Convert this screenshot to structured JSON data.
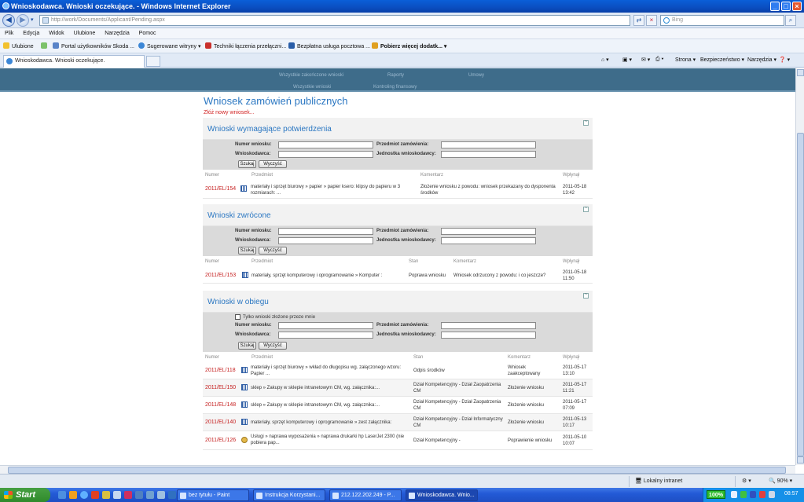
{
  "window": {
    "title": "Wnioskodawca. Wnioski oczekujące. - Windows Internet Explorer"
  },
  "address": {
    "url": "http://work/Documents/Applicant/Pending.aspx",
    "search_placeholder": "Bing"
  },
  "menu": [
    "Plik",
    "Edycja",
    "Widok",
    "Ulubione",
    "Narzędzia",
    "Pomoc"
  ],
  "favorites": {
    "label": "Ulubione",
    "items": [
      "Portal użytkowników Skoda ...",
      "Sugerowane witryny",
      "Techniki łączenia przełączni...",
      "Bezpłatna usługa pocztowa ...",
      "Pobierz więcej dodatk..."
    ]
  },
  "tab": {
    "label": "Wnioskodawca. Wnioski oczekujące."
  },
  "commands": [
    "Strona",
    "Bezpieczeństwo",
    "Narzędzia"
  ],
  "site_nav": {
    "row1": [
      "Wszystkie zakończone wnioski",
      "Raporty",
      "Umowy"
    ],
    "row2": [
      "Wszystkie wnioski",
      "Kontroling finansowy"
    ]
  },
  "page": {
    "title": "Wniosek zamówień publicznych",
    "new_request": "Złóż nowy wniosek..."
  },
  "filter_labels": {
    "number": "Numer wniosku:",
    "subject": "Przedmiot zamówienia:",
    "applicant": "Wnioskodawca:",
    "unit": "Jednostka wnioskodawcy:",
    "search": "Szukaj",
    "clear": "Wyczyść",
    "only_mine": "Tylko wnioski złożone przeze mnie"
  },
  "sections": [
    {
      "title": "Wnioski wymagające potwierdzenia",
      "columns": [
        "Numer",
        "Przedmiot",
        "Komentarz",
        "Wpłynął"
      ],
      "rows": [
        {
          "number": "2011/EL/154",
          "subject": "materiały i sprzęt biurowy » papier » papier ksero: klipsy do papieru w 3 rozmiarach: ...",
          "comment": "Złożenie wniosku z powodu: wniosek przekazany do dysponenta środków",
          "date": "2011-05-18 13:42"
        }
      ]
    },
    {
      "title": "Wnioski zwrócone",
      "columns": [
        "Numer",
        "Przedmiot",
        "Stan",
        "Komentarz",
        "Wpłynął"
      ],
      "rows": [
        {
          "number": "2011/EL/153",
          "subject": "materiały, sprzęt komputerowy i oprogramowanie » Komputer :",
          "status": "Poprawa wniosku",
          "comment": "Wniosek odrzucony z powodu: i co jeszcze?",
          "date": "2011-05-18 11:50"
        }
      ]
    },
    {
      "title": "Wnioski w obiegu",
      "columns": [
        "Numer",
        "Przedmiot",
        "Stan",
        "Komentarz",
        "Wpłynął"
      ],
      "rows": [
        {
          "number": "2011/EL/118",
          "subject": "materiały i sprzęt biurowy » wkład do długopisu wg. załączonego wzoru: Papier ...",
          "status": "Odpis środków",
          "comment": "Wniosek zaakceptowany",
          "date": "2011-05-17 13:10"
        },
        {
          "number": "2011/EL/150",
          "subject": "sklep » Zakupy w sklepie intranetowym CM, wg. załącznika:...",
          "status": "Dział Kompetencyjny - Dział Zaopatrzenia CM",
          "comment": "Złożenie wniosku",
          "date": "2011-05-17 11:21"
        },
        {
          "number": "2011/EL/148",
          "subject": "sklep » Zakupy w sklepie intranetowym CM, wg. załącznika:...",
          "status": "Dział Kompetencyjny - Dział Zaopatrzenia CM",
          "comment": "Złożenie wniosku",
          "date": "2011-05-17 07:09"
        },
        {
          "number": "2011/EL/140",
          "subject": "materiały, sprzęt komputerowy i oprogramowanie » zest załącznika:",
          "status": "Dział Kompetencyjny - Dział Informatyczny CM",
          "comment": "Złożenie wniosku",
          "date": "2011-05-13 10:17"
        },
        {
          "number": "2011/EL/126",
          "subject": "Usługi » naprawa wyposażenia » naprawa drukarki hp LaserJet 2300 (nie pobiera pap...",
          "status": "Dział Kompetencyjny -",
          "comment": "Poprawienie wniosku",
          "date": "2011-05-10 10:07"
        }
      ]
    }
  ],
  "status_bar": {
    "zone": "Lokalny intranet",
    "zoom": "90%"
  },
  "taskbar": {
    "start": "Start",
    "tasks": [
      "bez tytułu - Paint",
      "Instrukcja Korzystani...",
      "212.122.202.249 - P...",
      "Wnioskodawca. Wnio..."
    ],
    "battery": "100%",
    "clock": "08:57"
  }
}
